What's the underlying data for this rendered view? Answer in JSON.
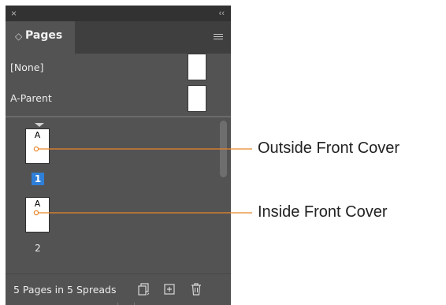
{
  "panel": {
    "close_glyph": "×",
    "collapse_glyph": "‹‹",
    "tab_chevron": "◇",
    "tab_label": "Pages",
    "menu_icon": "hamburger-icon"
  },
  "parents": [
    {
      "label": "[None]"
    },
    {
      "label": "A-Parent"
    }
  ],
  "pages": [
    {
      "prefix": "A",
      "number": "1",
      "selected": true
    },
    {
      "prefix": "A",
      "number": "2",
      "selected": false
    }
  ],
  "footer": {
    "status": "5 Pages in 5 Spreads",
    "icons": [
      "edit-page-size-icon",
      "new-page-icon",
      "delete-page-icon"
    ]
  },
  "callouts": [
    {
      "label": "Outside Front Cover"
    },
    {
      "label": "Inside Front Cover"
    }
  ],
  "colors": {
    "panel_bg": "#535353",
    "selection": "#2f7fd8",
    "callout_line": "#e8862a"
  }
}
